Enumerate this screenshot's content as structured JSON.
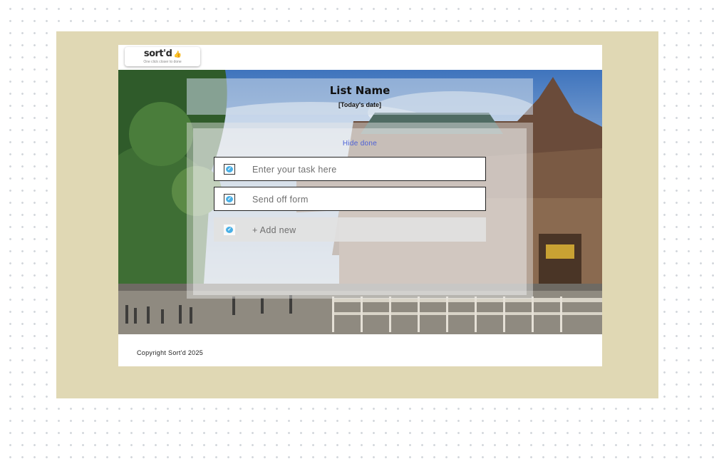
{
  "brand": {
    "name": "sort'd",
    "tagline": "One click closer to done"
  },
  "list": {
    "title": "List Name",
    "date": "[Today's date]",
    "hide_done_label": "Hide done",
    "tasks": [
      {
        "placeholder": "Enter your task here",
        "value": ""
      },
      {
        "text": "Send off form"
      }
    ],
    "add_new_label": "+ Add new"
  },
  "footer": {
    "copyright": "Copyright Sort'd 2025"
  },
  "colors": {
    "board": "#e0d8b4",
    "link": "#4c60d6",
    "check": "#4ab0e6",
    "brand_accent": "#a855f7"
  },
  "icons": {
    "logo_thumb": "thumbs-up-icon",
    "task_check": "check-circle-icon"
  }
}
